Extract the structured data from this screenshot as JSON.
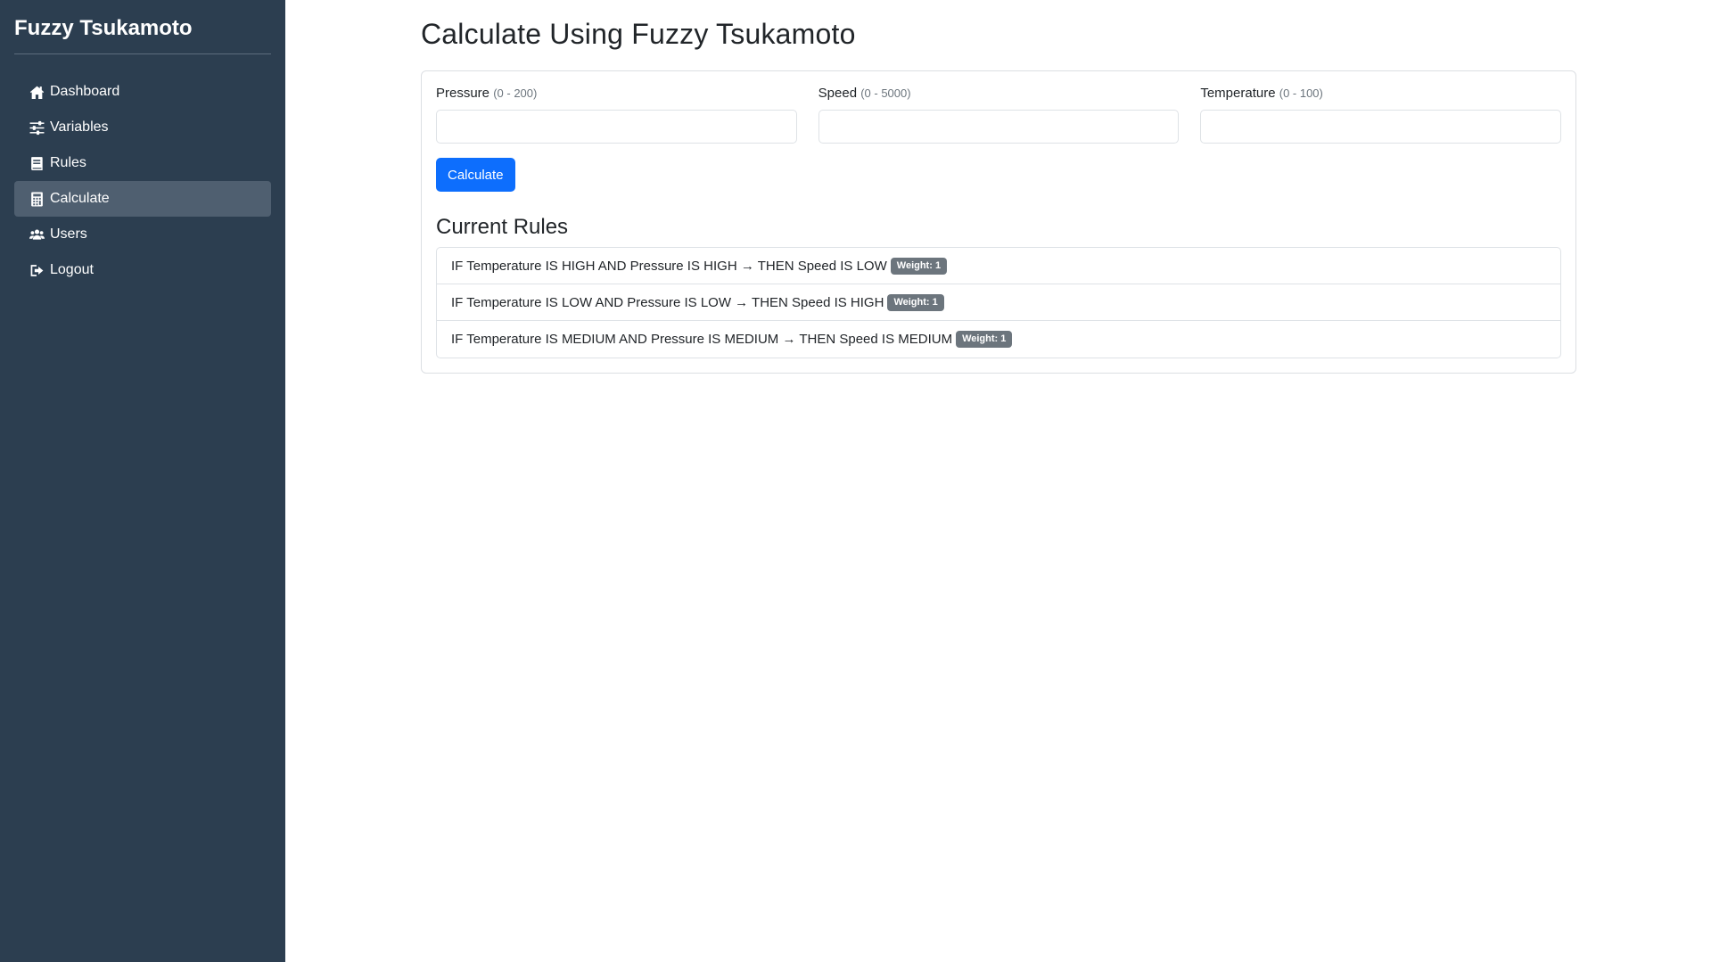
{
  "sidebar": {
    "brand": "Fuzzy Tsukamoto",
    "items": [
      {
        "label": "Dashboard",
        "icon": "home-icon"
      },
      {
        "label": "Variables",
        "icon": "sliders-icon"
      },
      {
        "label": "Rules",
        "icon": "book-icon"
      },
      {
        "label": "Calculate",
        "icon": "calculator-icon",
        "active": true
      },
      {
        "label": "Users",
        "icon": "users-icon"
      },
      {
        "label": "Logout",
        "icon": "logout-icon"
      }
    ]
  },
  "main": {
    "title": "Calculate Using Fuzzy Tsukamoto",
    "form": {
      "fields": [
        {
          "label": "Pressure",
          "range": "(0 - 200)",
          "value": "",
          "placeholder": ""
        },
        {
          "label": "Speed",
          "range": "(0 - 5000)",
          "value": "",
          "placeholder": ""
        },
        {
          "label": "Temperature",
          "range": "(0 - 100)",
          "value": "",
          "placeholder": ""
        }
      ],
      "submit_label": "Calculate"
    },
    "rules_title": "Current Rules",
    "rules": [
      {
        "text": "IF Temperature IS HIGH AND Pressure IS HIGH → THEN Speed IS LOW",
        "badge": "Weight: 1"
      },
      {
        "text": "IF Temperature IS LOW AND Pressure IS LOW → THEN Speed IS HIGH",
        "badge": "Weight: 1"
      },
      {
        "text": "IF Temperature IS MEDIUM AND Pressure IS MEDIUM → THEN Speed IS MEDIUM",
        "badge": "Weight: 1"
      }
    ]
  },
  "colors": {
    "sidebar_bg": "#2c3e50",
    "active_item_bg": "#4f5f70",
    "primary": "#0d6efd",
    "badge_bg": "#6c757d"
  }
}
